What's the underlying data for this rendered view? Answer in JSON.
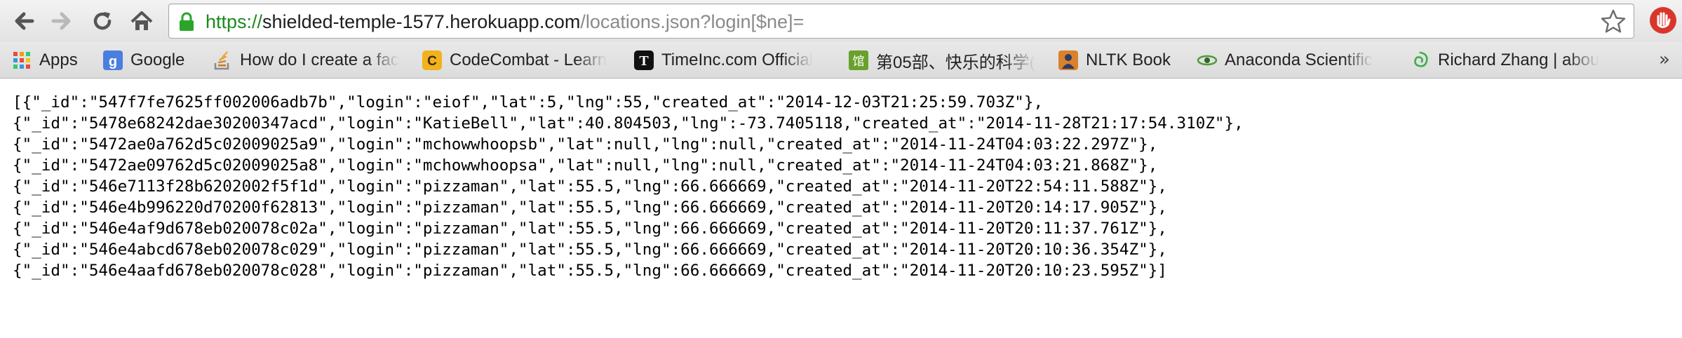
{
  "browser": {
    "url": {
      "scheme": "https://",
      "host": "shielded-temple-1577.herokuapp.com",
      "path": "/locations.json?login[$ne]="
    }
  },
  "bookmarks": [
    {
      "label": "Apps",
      "icon": "apps-grid-icon"
    },
    {
      "label": "Google",
      "icon": "google-icon"
    },
    {
      "label": "How do I create a fac",
      "icon": "stackoverflow-icon"
    },
    {
      "label": "CodeCombat - Learn",
      "icon": "codecombat-icon"
    },
    {
      "label": "TimeInc.com Official",
      "icon": "timeinc-icon"
    },
    {
      "label": "第05部、快乐的科学(",
      "icon": "library-icon"
    },
    {
      "label": "NLTK Book",
      "icon": "nltk-icon"
    },
    {
      "label": "Anaconda Scientific",
      "icon": "anaconda-icon"
    },
    {
      "label": "Richard Zhang | abou",
      "icon": "swirl-icon"
    }
  ],
  "colors": {
    "url_scheme": "#1c8a1c",
    "lock": "#2aa52a",
    "extension": "#d9362b"
  },
  "page": {
    "lines": [
      "[{\"_id\":\"547f7fe7625ff002006adb7b\",\"login\":\"eiof\",\"lat\":5,\"lng\":55,\"created_at\":\"2014-12-03T21:25:59.703Z\"},",
      "{\"_id\":\"5478e68242dae30200347acd\",\"login\":\"KatieBell\",\"lat\":40.804503,\"lng\":-73.7405118,\"created_at\":\"2014-11-28T21:17:54.310Z\"},",
      "{\"_id\":\"5472ae0a762d5c02009025a9\",\"login\":\"mchowwhoopsb\",\"lat\":null,\"lng\":null,\"created_at\":\"2014-11-24T04:03:22.297Z\"},",
      "{\"_id\":\"5472ae09762d5c02009025a8\",\"login\":\"mchowwhoopsa\",\"lat\":null,\"lng\":null,\"created_at\":\"2014-11-24T04:03:21.868Z\"},",
      "{\"_id\":\"546e7113f28b6202002f5f1d\",\"login\":\"pizzaman\",\"lat\":55.5,\"lng\":66.666669,\"created_at\":\"2014-11-20T22:54:11.588Z\"},",
      "{\"_id\":\"546e4b996220d70200f62813\",\"login\":\"pizzaman\",\"lat\":55.5,\"lng\":66.666669,\"created_at\":\"2014-11-20T20:14:17.905Z\"},",
      "{\"_id\":\"546e4af9d678eb020078c02a\",\"login\":\"pizzaman\",\"lat\":55.5,\"lng\":66.666669,\"created_at\":\"2014-11-20T20:11:37.761Z\"},",
      "{\"_id\":\"546e4abcd678eb020078c029\",\"login\":\"pizzaman\",\"lat\":55.5,\"lng\":66.666669,\"created_at\":\"2014-11-20T20:10:36.354Z\"},",
      "{\"_id\":\"546e4aafd678eb020078c028\",\"login\":\"pizzaman\",\"lat\":55.5,\"lng\":66.666669,\"created_at\":\"2014-11-20T20:10:23.595Z\"}]"
    ]
  }
}
